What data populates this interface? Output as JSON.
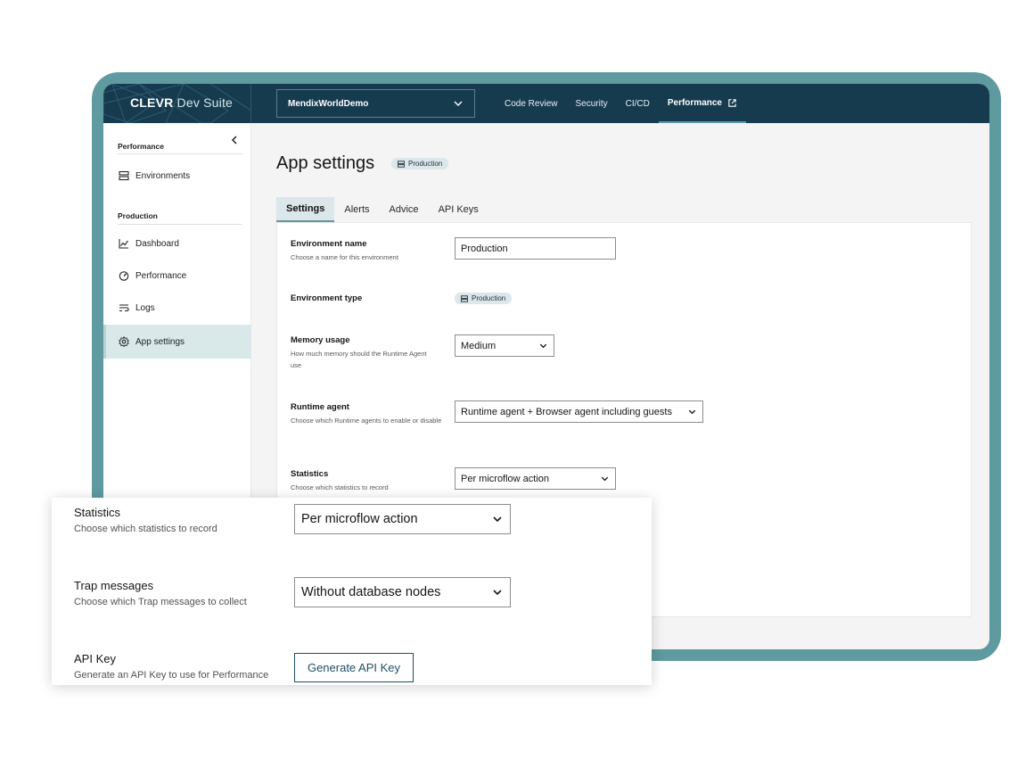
{
  "header": {
    "brand": "CLEVR",
    "brand_suffix": "Dev Suite",
    "app_selector": "MendixWorldDemo",
    "nav": [
      "Code Review",
      "Security",
      "CI/CD",
      "Performance"
    ]
  },
  "sidebar": {
    "section1": "Performance",
    "environments": "Environments",
    "section2": "Production",
    "items": [
      "Dashboard",
      "Performance",
      "Logs",
      "App settings"
    ]
  },
  "page": {
    "title": "App settings",
    "env_badge": "Production",
    "tabs": [
      "Settings",
      "Alerts",
      "Advice",
      "API Keys"
    ]
  },
  "form": {
    "env_name": {
      "label": "Environment name",
      "help": "Choose a name for this environment",
      "value": "Production"
    },
    "env_type": {
      "label": "Environment type",
      "value": "Production"
    },
    "memory": {
      "label": "Memory usage",
      "help": "How much memory should the Runtime Agent use",
      "value": "Medium"
    },
    "runtime": {
      "label": "Runtime agent",
      "help": "Choose which Runtime agents to enable or disable",
      "value": "Runtime agent + Browser agent including guests"
    },
    "statistics": {
      "label": "Statistics",
      "help": "Choose which statistics to record",
      "value": "Per microflow action"
    }
  },
  "zoom": {
    "statistics": {
      "label": "Statistics",
      "help": "Choose which statistics to record",
      "value": "Per microflow action"
    },
    "trap": {
      "label": "Trap messages",
      "help": "Choose which Trap messages to collect",
      "value": "Without database nodes"
    },
    "api": {
      "label": "API Key",
      "help": "Generate an API Key to use for Performance",
      "button": "Generate API Key"
    }
  },
  "colors": {
    "frame": "#5e9aa0",
    "topbar": "#163b4f",
    "accent_bg": "#dbe7ea"
  }
}
